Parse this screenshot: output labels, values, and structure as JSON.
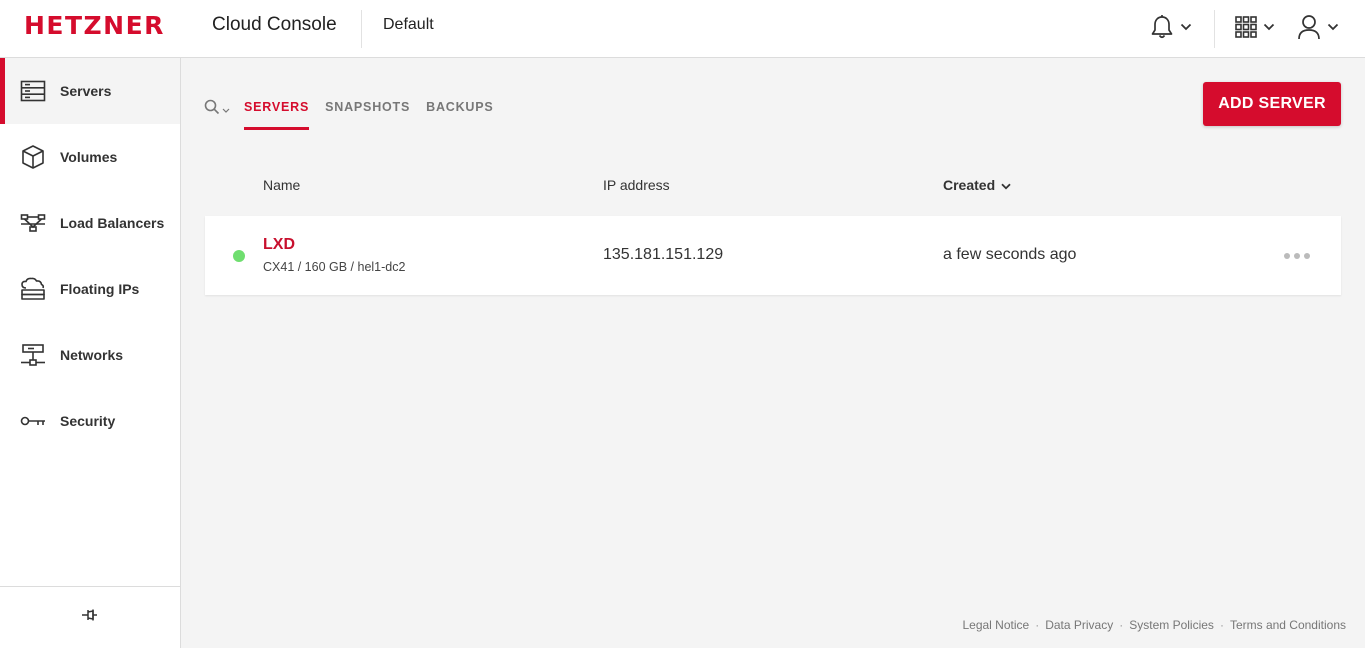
{
  "header": {
    "brand": "HETZNER",
    "app_title": "Cloud Console",
    "project": "Default",
    "icons": [
      "bell-icon",
      "grid-icon",
      "user-icon"
    ]
  },
  "sidebar": {
    "items": [
      {
        "label": "Servers",
        "icon": "server-icon",
        "active": true
      },
      {
        "label": "Volumes",
        "icon": "cube-icon",
        "active": false
      },
      {
        "label": "Load Balancers",
        "icon": "load-balancer-icon",
        "active": false
      },
      {
        "label": "Floating IPs",
        "icon": "floating-ip-icon",
        "active": false
      },
      {
        "label": "Networks",
        "icon": "network-icon",
        "active": false
      },
      {
        "label": "Security",
        "icon": "key-icon",
        "active": false
      }
    ],
    "footer_icon": "pin-icon"
  },
  "tabs": [
    {
      "label": "SERVERS",
      "active": true
    },
    {
      "label": "SNAPSHOTS",
      "active": false
    },
    {
      "label": "BACKUPS",
      "active": false
    }
  ],
  "actions": {
    "add_server": "ADD SERVER"
  },
  "table": {
    "columns": {
      "name": "Name",
      "ip": "IP address",
      "created": "Created"
    },
    "rows": [
      {
        "name": "LXD",
        "meta": "CX41 / 160 GB / hel1-dc2",
        "ip": "135.181.151.129",
        "created": "a few seconds ago",
        "status": "running"
      }
    ]
  },
  "footer": {
    "links": [
      "Legal Notice",
      "Data Privacy",
      "System Policies",
      "Terms and Conditions"
    ],
    "separator": "·"
  },
  "colors": {
    "brand": "#d50c2d",
    "status_running": "#6fde6f",
    "background": "#f4f4f4"
  }
}
